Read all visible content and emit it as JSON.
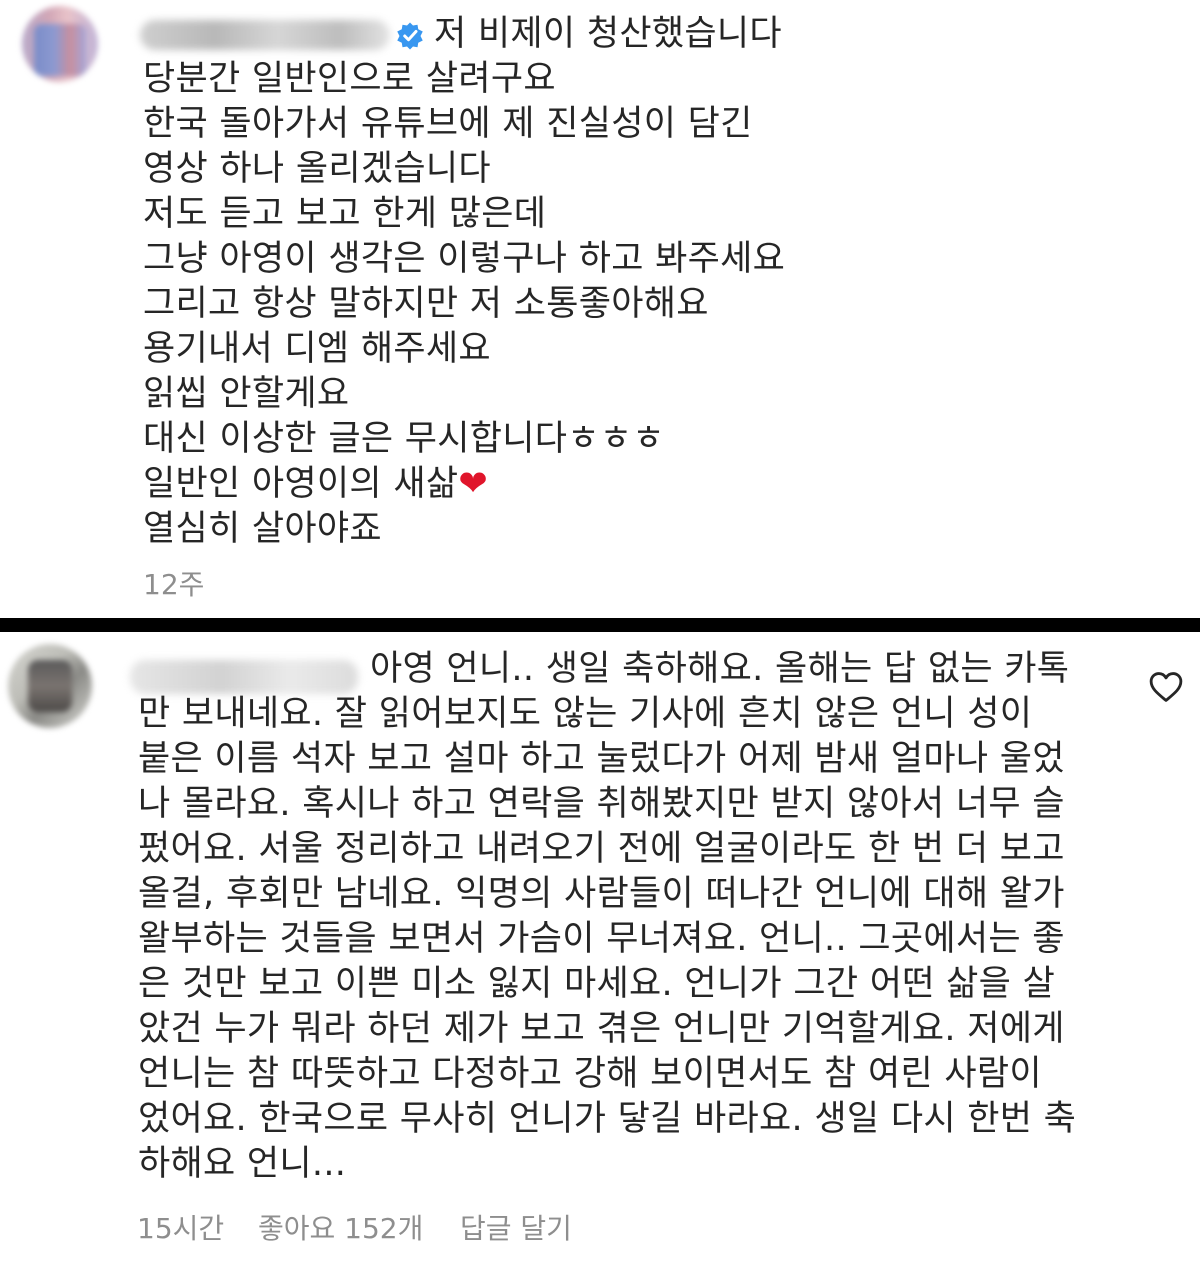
{
  "top_comment": {
    "first_line": "저 비제이 청산했습니다",
    "lines": [
      "당분간 일반인으로 살려구요",
      "한국 돌아가서 유튜브에 제 진실성이 담긴",
      "영상 하나 올리겠습니다",
      "저도 듣고 보고 한게 많은데",
      "그냥 아영이 생각은 이렇구나 하고 봐주세요",
      "그리고 항상 말하지만 저 소통좋아해요",
      "용기내서 디엠 해주세요",
      "읽씹 안할게요",
      "대신 이상한 글은 무시합니다ㅎㅎㅎ",
      "일반인 아영이의 새삶",
      "열심히 살아야죠"
    ],
    "heart_emoji": "❤",
    "time": "12주",
    "verified_icon": "verified-badge-icon",
    "colors": {
      "verified": "#3897f0",
      "heart": "#e0152b"
    }
  },
  "bottom_comment": {
    "first_line": "아영 언니.. 생일 축하해요. 올해는 답 없는 카톡",
    "lines": [
      "만 보내네요. 잘 읽어보지도 않는 기사에 흔치 않은 언니 성이",
      "붙은 이름 석자 보고 설마 하고 눌렀다가 어제 밤새 얼마나 울었",
      "나 몰라요. 혹시나 하고 연락을 취해봤지만 받지 않아서 너무 슬",
      "펐어요. 서울 정리하고 내려오기 전에 얼굴이라도 한 번 더 보고",
      "올걸, 후회만 남네요. 익명의 사람들이 떠나간 언니에 대해 왈가",
      "왈부하는 것들을 보면서 가슴이 무너져요. 언니.. 그곳에서는 좋",
      "은 것만 보고 이쁜 미소 잃지 마세요. 언니가 그간 어떤 삶을 살",
      "았건 누가 뭐라 하던 제가 보고 겪은 언니만 기억할게요. 저에게",
      "언니는 참 따뜻하고 다정하고 강해 보이면서도 참 여린 사람이",
      "었어요. 한국으로 무사히 언니가 닿길 바라요. 생일 다시 한번 축",
      "하해요 언니..."
    ],
    "time": "15시간",
    "likes": "좋아요 152개",
    "reply": "답글 달기",
    "like_icon": "heart-outline-icon"
  }
}
